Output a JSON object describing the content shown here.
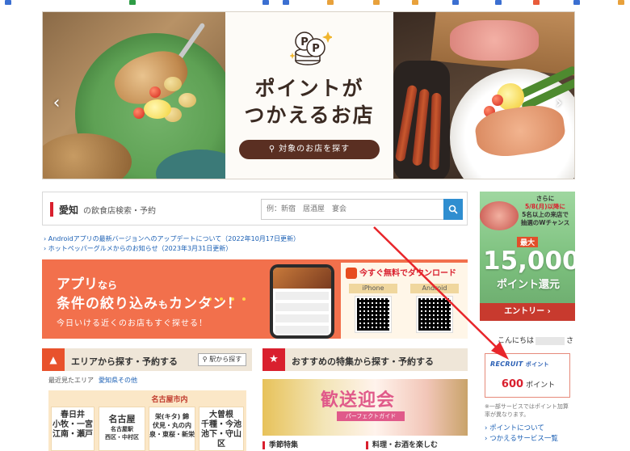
{
  "hero": {
    "title_line1": "ポイントが",
    "title_line2": "つかえるお店",
    "button_label": "対象のお店を探す",
    "prev_icon": "chevron-left-icon",
    "next_icon": "chevron-right-icon"
  },
  "search": {
    "area": "愛知",
    "subtitle": "の飲食店検索・予約",
    "placeholder": "例：新宿　居酒屋　宴会",
    "button_icon": "search-icon"
  },
  "notices": [
    "Androidアプリの最新バージョンへのアップデートについて（2022年10月17日更新）",
    "ホットペッパーグルメからのお知らせ（2023年3月31日更新）"
  ],
  "app_banner": {
    "line1_big": "アプリ",
    "line1_small": "なら",
    "line2_a": "条件の絞り込み",
    "line2_small": "も",
    "line2_b": "カンタン！",
    "line3": "今日いける近くのお店もすぐ探せる！",
    "download_title": "今すぐ無料でダウンロード",
    "iphone_label": "iPhone",
    "android_label": "Android"
  },
  "area_section": {
    "title": "エリアから探す・予約する",
    "station_button": "駅から探す",
    "recent_label": "最近見たエリア",
    "recent_link": "愛知県その他",
    "nagoya_header": "名古屋市内",
    "cells": {
      "kasugai": [
        "春日井",
        "小牧・一宮",
        "江南・瀬戸"
      ],
      "nagoya_main": "名古屋",
      "nagoya_sub": [
        "名古屋駅",
        "西区・中村区"
      ],
      "sakae": [
        "栄(キタ) 錦",
        "伏見・丸の内",
        "泉・東桜・新栄"
      ],
      "ozone": [
        "大曽根",
        "千種・今池",
        "池下・守山区"
      ]
    }
  },
  "recommend_section": {
    "title": "おすすめの特集から探す・予約する",
    "feature_title": "歓送迎会",
    "feature_sub": "パーフェクトガイド",
    "tabs": [
      "季節特集",
      "料理・お酒を楽しむ"
    ]
  },
  "promo": {
    "line1": "さらに",
    "line2": "5/8(月)以降に",
    "line3": "5名以上の来店で",
    "line4": "抽選のWチャンス",
    "max_label": "最大",
    "amount": "15,000",
    "return_label": "ポイント還元",
    "entry_label": "エントリー ›"
  },
  "user": {
    "greeting_prefix": "こんにちは",
    "greeting_suffix": "さん",
    "brand": "RECRUIT",
    "brand_sub": "ポイント",
    "points": "600",
    "points_unit": "ポイント",
    "note": "※一部サービスではポイント加算率が異なります。",
    "links": [
      "ポイントについて",
      "つかえるサービス一覧"
    ]
  },
  "colors": {
    "accent_red": "#d9202e",
    "link_blue": "#1a5fb4",
    "app_banner_bg": "#f2704c",
    "search_button": "#2f8ed0"
  }
}
